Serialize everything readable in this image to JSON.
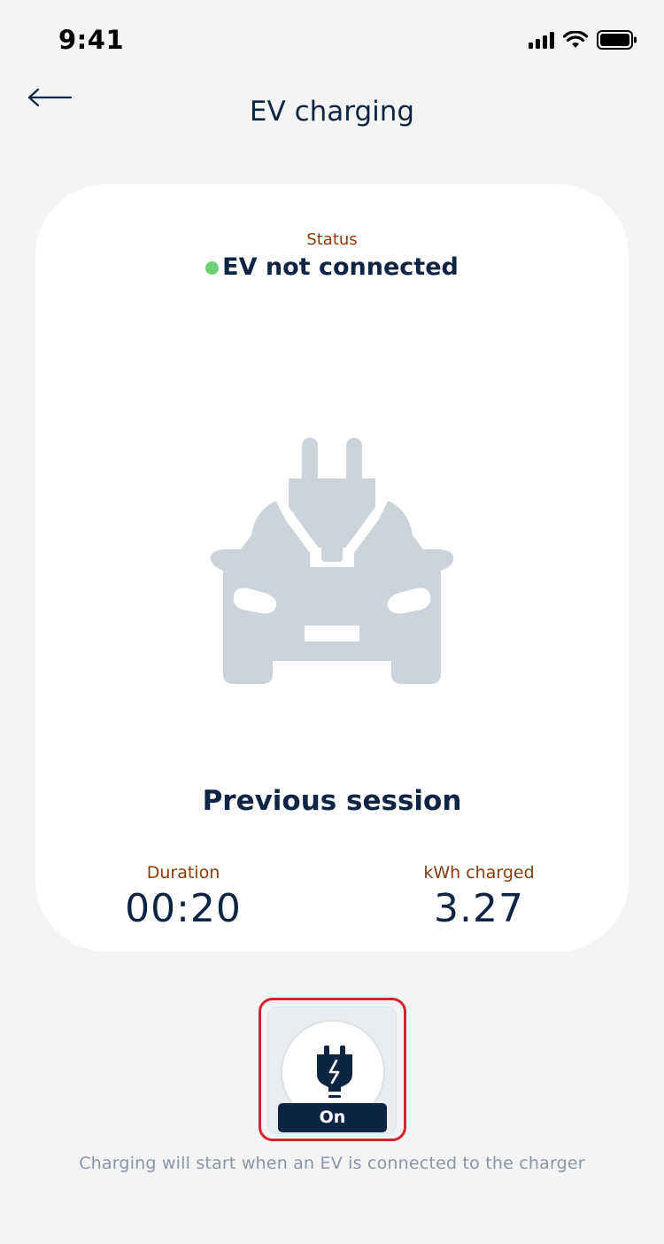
{
  "status_bar": {
    "time": "9:41"
  },
  "header": {
    "title": "EV charging"
  },
  "card": {
    "status_label": "Status",
    "status_value": "EV not connected",
    "session_title": "Previous session",
    "duration_label": "Duration",
    "duration_value": "00:20",
    "kwh_label": "kWh charged",
    "kwh_value": "3.27"
  },
  "toggle": {
    "label": "On",
    "icon": "plug-lightning-icon"
  },
  "hint": "Charging will start when an EV is connected to the charger",
  "colors": {
    "primary": "#0e2443",
    "accent_label": "#8a3b0a",
    "status_ok": "#6fcf75",
    "illustration": "#cdd3da",
    "highlight": "#d3232d"
  }
}
